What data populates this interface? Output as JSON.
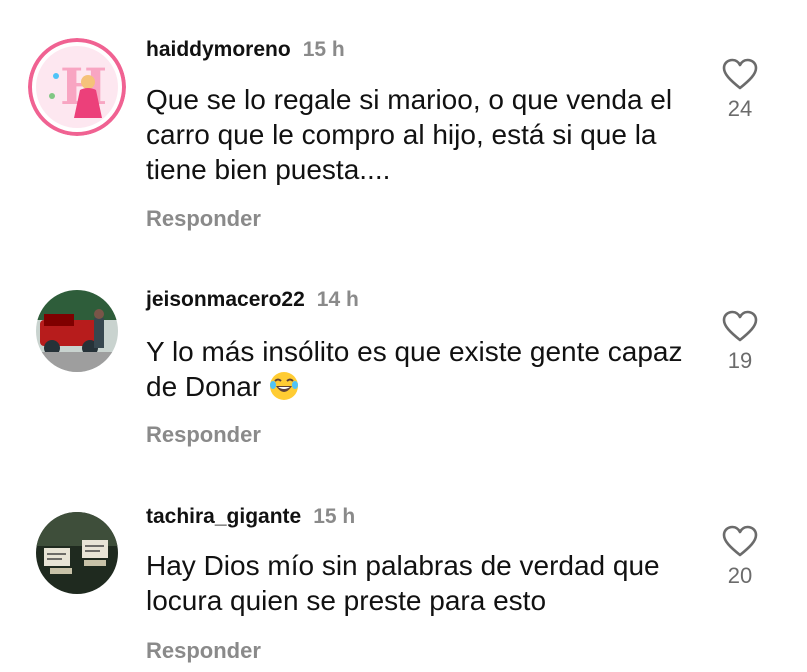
{
  "comments": [
    {
      "username": "haiddymoreno",
      "time": "15 h",
      "text": "Que se lo regale si marioo, o que venda el carro que le compro al hijo, está si que la tiene bien puesta....",
      "reply_label": "Responder",
      "likes": "24",
      "avatar": "avatar-icon"
    },
    {
      "username": "jeisonmacero22",
      "time": "14 h",
      "text": "Y lo más insólito es que existe gente capaz de Donar",
      "emoji": "laughing-emoji",
      "reply_label": "Responder",
      "likes": "19",
      "avatar": "avatar-icon"
    },
    {
      "username": "tachira_gigante",
      "time": "15 h",
      "text": "Hay Dios mío sin palabras de verdad que locura quien se preste para esto",
      "reply_label": "Responder",
      "likes": "20",
      "avatar": "avatar-icon"
    }
  ],
  "colors": {
    "text": "#111111",
    "muted": "#8a8a8a",
    "avatar_ring": "#f48fb1"
  }
}
